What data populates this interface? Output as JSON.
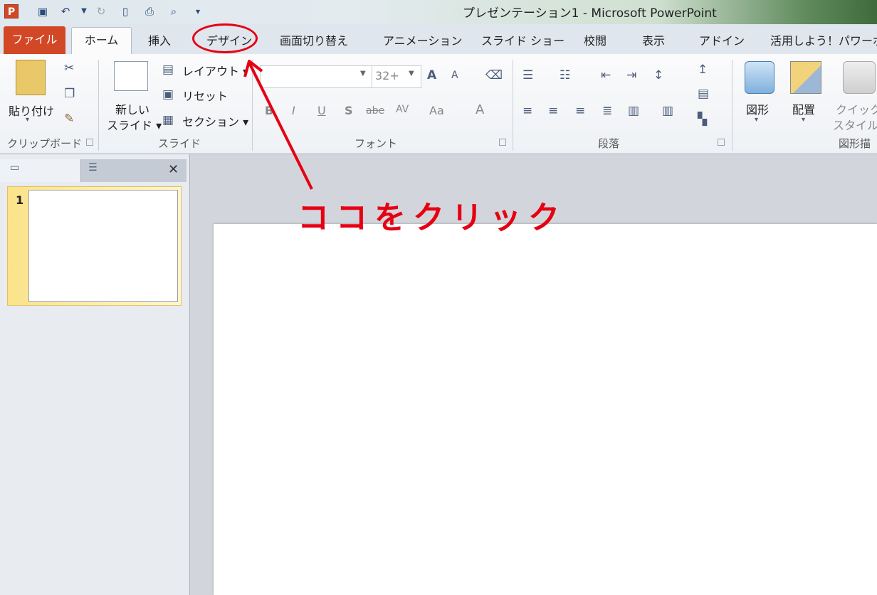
{
  "app": {
    "title": "プレゼンテーション1 - Microsoft PowerPoint",
    "logo_letter": "P"
  },
  "qat": [
    "save-icon",
    "undo-icon",
    "dropdown-icon",
    "redo-icon",
    "new-icon",
    "print-icon",
    "preview-icon",
    "customize-icon"
  ],
  "tabs": {
    "file": "ファイル",
    "home": "ホーム",
    "insert": "挿入",
    "design": "デザイン",
    "transitions": "画面切り替え",
    "animations": "アニメーション",
    "slideshow": "スライド ショー",
    "review": "校閲",
    "view": "表示",
    "addins": "アドイン",
    "extra": "活用しよう！パワーポ"
  },
  "ribbon": {
    "clipboard": {
      "paste": "貼り付け",
      "label": "クリップボード"
    },
    "slides": {
      "new_slide_1": "新しい",
      "new_slide_2": "スライド ▾",
      "layout": "レイアウト ▾",
      "reset": "リセット",
      "section": "セクション ▾",
      "label": "スライド"
    },
    "font": {
      "size": "32+",
      "label": "フォント",
      "B": "B",
      "I": "I",
      "U": "U",
      "S": "S",
      "abc": "abe",
      "av": "AV",
      "aa": "Aa",
      "a": "A"
    },
    "paragraph": {
      "label": "段落"
    },
    "drawing": {
      "shapes": "図形",
      "arrange": "配置",
      "quick_1": "クイック",
      "quick_2": "スタイル",
      "label": "図形描"
    }
  },
  "slides_panel": {
    "number": "1"
  },
  "annotation": {
    "text": "ココをクリック",
    "color": "#e60012"
  },
  "colors": {
    "file_tab": "#d24726",
    "accent_red": "#e60012",
    "selected_thumb": "#fbe38a"
  }
}
